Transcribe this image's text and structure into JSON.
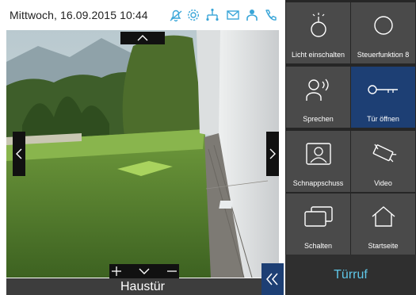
{
  "status": {
    "datetime": "Mittwoch, 16.09.2015 10:44",
    "icons": [
      "bell-icon",
      "gear-icon",
      "network-icon",
      "mail-icon",
      "person-icon",
      "phone-icon"
    ],
    "icon_color": "#3aa6d8"
  },
  "camera": {
    "caption": "Haustür"
  },
  "tiles": [
    {
      "label": "Licht einschalten",
      "icon": "bulb-icon",
      "active": false
    },
    {
      "label": "Steuerfunktion 8",
      "icon": "circle-icon",
      "active": false
    },
    {
      "label": "Sprechen",
      "icon": "speak-icon",
      "active": false
    },
    {
      "label": "Tür öffnen",
      "icon": "key-icon",
      "active": true
    },
    {
      "label": "Schnappschuss",
      "icon": "snapshot-icon",
      "active": false
    },
    {
      "label": "Video",
      "icon": "video-camera-icon",
      "active": false
    },
    {
      "label": "Schalten",
      "icon": "switch-icon",
      "active": false
    },
    {
      "label": "Startseite",
      "icon": "home-icon",
      "active": false
    }
  ],
  "call": {
    "label": "Türruf"
  },
  "colors": {
    "accent_blue": "#1d3f74",
    "call_text": "#5fc7e8",
    "tile_bg": "#4a4a4a",
    "panel_bg": "#262626"
  }
}
